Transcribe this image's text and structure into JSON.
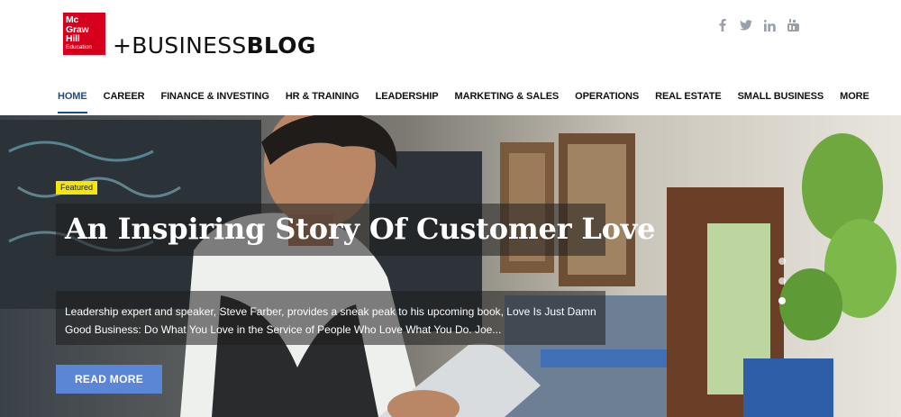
{
  "brand": {
    "logo_line1": "Mc",
    "logo_line2": "Graw",
    "logo_line3": "Hill",
    "logo_line4": "Education",
    "blog_prefix": "+BUSINESS",
    "blog_suffix": "BLOG",
    "logo_color": "#d6001c"
  },
  "social": [
    {
      "icon": "facebook-icon"
    },
    {
      "icon": "twitter-icon"
    },
    {
      "icon": "linkedin-icon"
    },
    {
      "icon": "youtube-icon"
    }
  ],
  "nav": {
    "items": [
      {
        "label": "HOME",
        "active": true
      },
      {
        "label": "CAREER"
      },
      {
        "label": "FINANCE & INVESTING"
      },
      {
        "label": "HR & TRAINING"
      },
      {
        "label": "LEADERSHIP"
      },
      {
        "label": "MARKETING & SALES"
      },
      {
        "label": "OPERATIONS"
      },
      {
        "label": "REAL ESTATE"
      },
      {
        "label": "SMALL BUSINESS"
      },
      {
        "label": "MORE"
      }
    ],
    "active_color": "#1c4d8a"
  },
  "hero": {
    "badge": "Featured",
    "headline": "An Inspiring Story Of Customer Love",
    "excerpt": "Leadership expert and speaker, Steve Farber, provides a sneak peak to his upcoming book, Love Is Just Damn Good Business: Do What You Love in the Service of People Who Love What You Do. Joe...",
    "read_more": "READ MORE",
    "badge_color": "#f5e50a",
    "button_color": "#5b86d6",
    "slides": 3
  }
}
